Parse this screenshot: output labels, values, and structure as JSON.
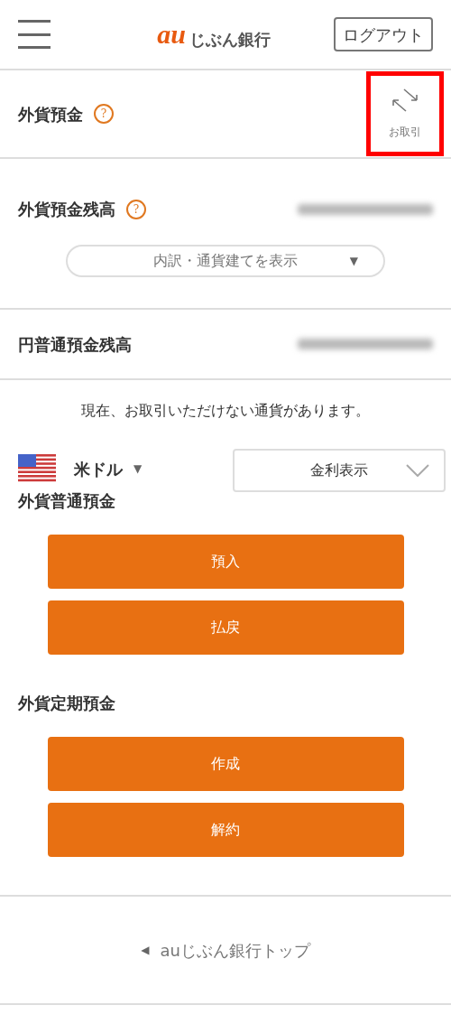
{
  "header": {
    "logo": {
      "mark": "au",
      "name": "じぶん銀行"
    },
    "logout": "ログアウト"
  },
  "deposit_header": {
    "title": "外貨預金",
    "help": "?",
    "transaction": {
      "label": "お取引",
      "highlighted": true
    }
  },
  "balance": {
    "label": "外貨預金残高",
    "help": "?",
    "amount_blurred": true,
    "toggle": {
      "label": "内訳・通貨建てを表示",
      "caret": "▼"
    }
  },
  "yen_balance": {
    "label": "円普通預金残高",
    "amount_blurred": true
  },
  "notice": "現在、お取引いただけない通貨があります。",
  "currency": {
    "name": "米ドル",
    "caret": "▼",
    "rate_select": "金利表示"
  },
  "groups": [
    {
      "title": "外貨普通預金",
      "buttons": [
        "預入",
        "払戻"
      ]
    },
    {
      "title": "外貨定期預金",
      "buttons": [
        "作成",
        "解約"
      ]
    }
  ],
  "footer_link": {
    "arrow": "◀",
    "label": "auじぶん銀行トップ"
  }
}
